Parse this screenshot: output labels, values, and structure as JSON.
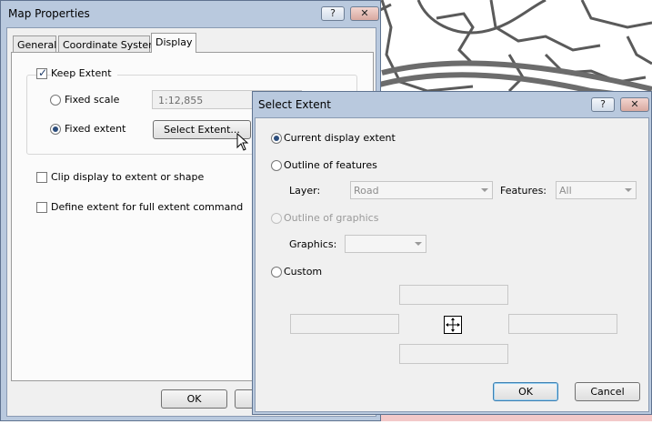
{
  "map_properties": {
    "title": "Map Properties",
    "help_btn": "?",
    "close_btn": "✕",
    "tabs": [
      "General",
      "Coordinate System",
      "Display"
    ],
    "keep_extent_label": "Keep Extent",
    "fixed_scale_label": "Fixed scale",
    "fixed_scale_value": "1:12,855",
    "fixed_extent_label": "Fixed extent",
    "select_extent_button": "Select Extent...",
    "clip_display_label": "Clip display to extent or shape",
    "define_extent_label": "Define extent for full extent command",
    "ok_button": "OK",
    "cancel_button": ""
  },
  "select_extent": {
    "title": "Select Extent",
    "help_btn": "?",
    "close_btn": "✕",
    "current_display_label": "Current display extent",
    "outline_features_label": "Outline of features",
    "layer_label": "Layer:",
    "layer_value": "Road",
    "features_label": "Features:",
    "features_value": "All",
    "outline_graphics_label": "Outline of graphics",
    "graphics_label": "Graphics:",
    "graphics_value": "",
    "custom_label": "Custom",
    "ok_button": "OK",
    "cancel_button": "Cancel"
  },
  "icons": {
    "move": "move-cross-icon",
    "cursor": "mouse-pointer-icon"
  }
}
